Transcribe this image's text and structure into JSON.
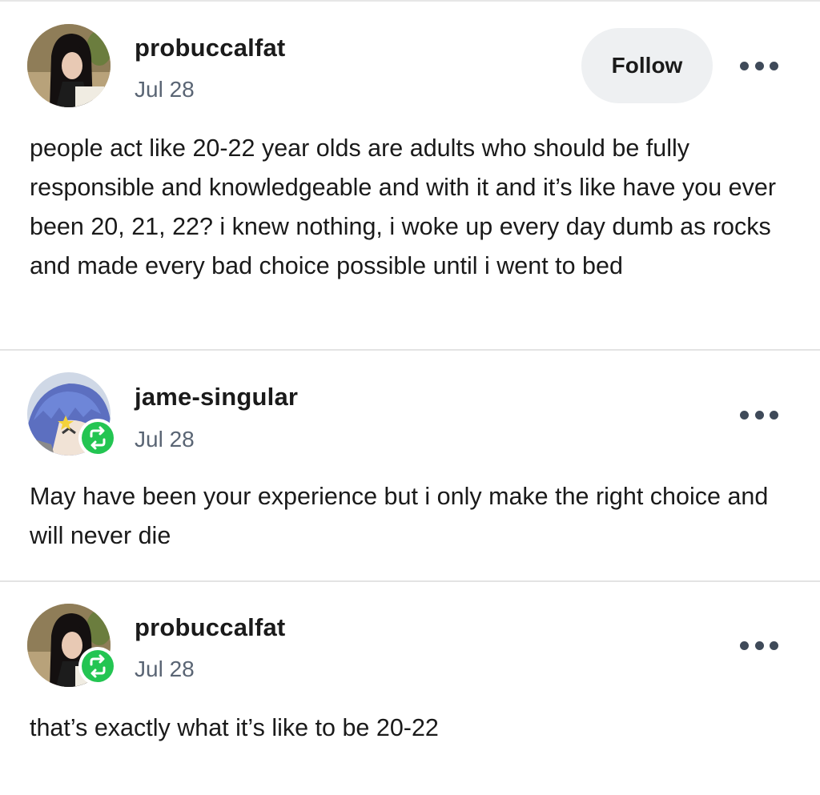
{
  "posts": [
    {
      "username": "probuccalfat",
      "date": "Jul 28",
      "follow_label": "Follow",
      "text": "people act like 20-22 year olds are adults who should be fully responsible and knowledgeable and with it and it’s like have you ever been 20, 21, 22? i knew nothing, i woke up every day dumb as rocks and made every bad choice possible until i went to bed"
    },
    {
      "username": "jame-singular",
      "date": "Jul 28",
      "text": "May have been your experience but i only make the right choice and will never die"
    },
    {
      "username": "probuccalfat",
      "date": "Jul 28",
      "text": "that’s exactly what it’s like to be 20-22"
    }
  ],
  "colors": {
    "reblog_badge": "#23c552",
    "follow_button_bg": "#eef0f2",
    "date_text": "#5a6574",
    "divider": "#e3e3e3"
  },
  "icons": {
    "more": "more-options-icon",
    "reblog": "reblog-icon"
  }
}
